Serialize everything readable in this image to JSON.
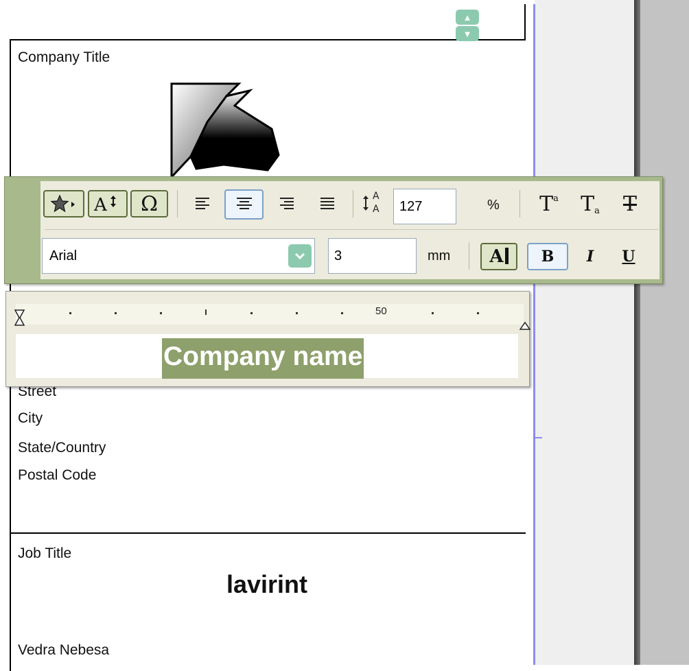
{
  "card_top": {
    "fields": [
      {
        "label": "Company Title"
      },
      {
        "label": "Street"
      },
      {
        "label": "City"
      },
      {
        "label": "State/Country"
      },
      {
        "label": "Postal Code"
      }
    ]
  },
  "card_bottom": {
    "job_title_label": "Job Title",
    "person_name": "lavirint",
    "footer_label": "Vedra Nebesa"
  },
  "editor": {
    "selected_text": "Company name",
    "ruler_label": "50"
  },
  "toolbar": {
    "row1": {
      "insert_glyph_icon": "star-menu-icon",
      "font_size_icon": "text-resize-icon",
      "symbol_char": "Ω",
      "align_icons": [
        "align-left-icon",
        "align-center-icon",
        "align-right-icon",
        "align-justify-icon"
      ],
      "active_align": "align-center",
      "line_spacing_icon": "line-spacing-icon",
      "line_spacing_value": "127",
      "line_spacing_unit": "%",
      "superscript_char": "T",
      "subscript_char": "T",
      "strikethrough_char": "T"
    },
    "row2": {
      "font_family": "Arial",
      "font_size_value": "3",
      "font_size_unit": "mm",
      "text_color_char": "A",
      "bold_char": "B",
      "italic_char": "I",
      "underline_char": "U",
      "active_style": "bold"
    }
  },
  "colors": {
    "selection": "#8ea06b",
    "toolbar_accent": "#a8b98c",
    "guide": "#8c8cf0"
  }
}
